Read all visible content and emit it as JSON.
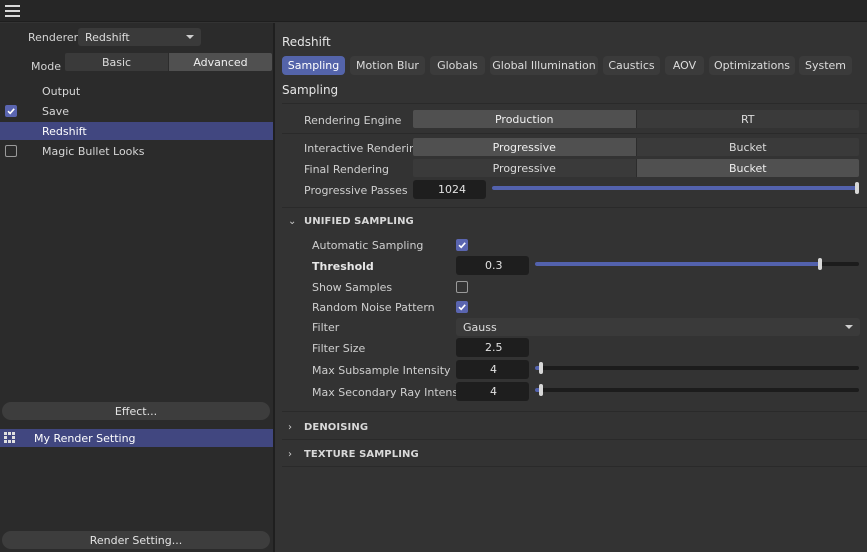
{
  "menu": {
    "icon": "hamburger-menu-icon"
  },
  "left": {
    "renderer_label": "Renderer",
    "renderer_value": "Redshift",
    "mode_label": "Mode",
    "mode_basic": "Basic",
    "mode_advanced": "Advanced",
    "mode_selected": "Advanced",
    "items": [
      {
        "label": "Output",
        "checkbox": false,
        "checked": false,
        "selected": false
      },
      {
        "label": "Save",
        "checkbox": true,
        "checked": true,
        "selected": false
      },
      {
        "label": "Redshift",
        "checkbox": false,
        "checked": false,
        "selected": true
      },
      {
        "label": "Magic Bullet Looks",
        "checkbox": true,
        "checked": false,
        "selected": false
      }
    ],
    "effect_button": "Effect...",
    "render_setting_item": "My Render Setting",
    "render_setting_button": "Render Setting..."
  },
  "right": {
    "title": "Redshift",
    "tabs": [
      "Sampling",
      "Motion Blur",
      "Globals",
      "Global Illumination",
      "Caustics",
      "AOV",
      "Optimizations",
      "System"
    ],
    "active_tab": "Sampling",
    "section_title": "Sampling",
    "rendering_engine_label": "Rendering Engine",
    "rendering_engine_options": [
      "Production",
      "RT"
    ],
    "rendering_engine_selected": "Production",
    "interactive_label": "Interactive Rendering",
    "interactive_options": [
      "Progressive",
      "Bucket"
    ],
    "interactive_selected": "Progressive",
    "final_label": "Final Rendering",
    "final_options": [
      "Progressive",
      "Bucket"
    ],
    "final_selected": "Bucket",
    "passes_label": "Progressive Passes",
    "passes_value": "1024",
    "passes_slider_fraction": 1.0
  },
  "unified": {
    "header": "UNIFIED SAMPLING",
    "expanded": true,
    "auto_sampling_label": "Automatic Sampling",
    "auto_sampling_checked": true,
    "threshold_label": "Threshold",
    "threshold_value": "0.3",
    "threshold_slider_fraction": 0.88,
    "show_samples_label": "Show Samples",
    "show_samples_checked": false,
    "random_noise_label": "Random Noise Pattern",
    "random_noise_checked": true,
    "filter_label": "Filter",
    "filter_value": "Gauss",
    "filter_size_label": "Filter Size",
    "filter_size_value": "2.5",
    "max_subsample_label": "Max Subsample Intensity",
    "max_subsample_value": "4",
    "max_subsample_slider_fraction": 0.02,
    "max_secondary_label": "Max Secondary Ray Intensity",
    "max_secondary_value": "4",
    "max_secondary_slider_fraction": 0.02
  },
  "collapsed_sections": [
    "DENOISING",
    "TEXTURE SAMPLING"
  ],
  "colors": {
    "accent": "#5464aa",
    "selection": "#414780",
    "background": "#333333",
    "panel": "#2b2b2b"
  }
}
